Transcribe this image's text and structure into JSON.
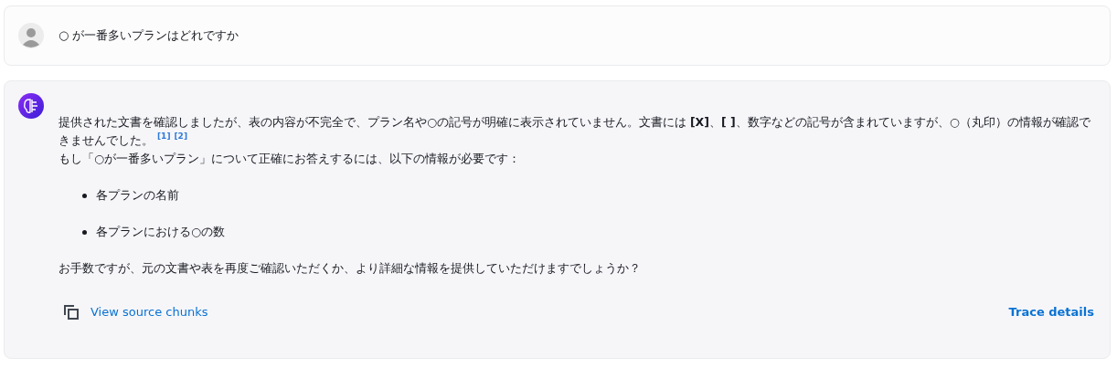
{
  "user_message": {
    "text": "○ が一番多いプランはどれですか"
  },
  "assistant_message": {
    "paragraphs": [
      {
        "text": "提供された文書を確認しましたが、表の内容が不完全で、プラン名や○の記号が明確に表示されていません。文書には **[X]**、**[ ]**、数字などの記号が含まれていますが、○（丸印）の情報が確認できませんでした。",
        "citations": [
          "[1]",
          "[2]"
        ]
      },
      {
        "text": "もし「○が一番多いプラン」について正確にお答えするには、以下の情報が必要です："
      }
    ],
    "bullets": [
      "各プランの名前",
      "各プランにおける○の数"
    ],
    "closing": "お手数ですが、元の文書や表を再度ご確認いただくか、より詳細な情報を提供していただけますでしょうか？",
    "source_link": "View source chunks",
    "trace_link": "Trace details"
  }
}
